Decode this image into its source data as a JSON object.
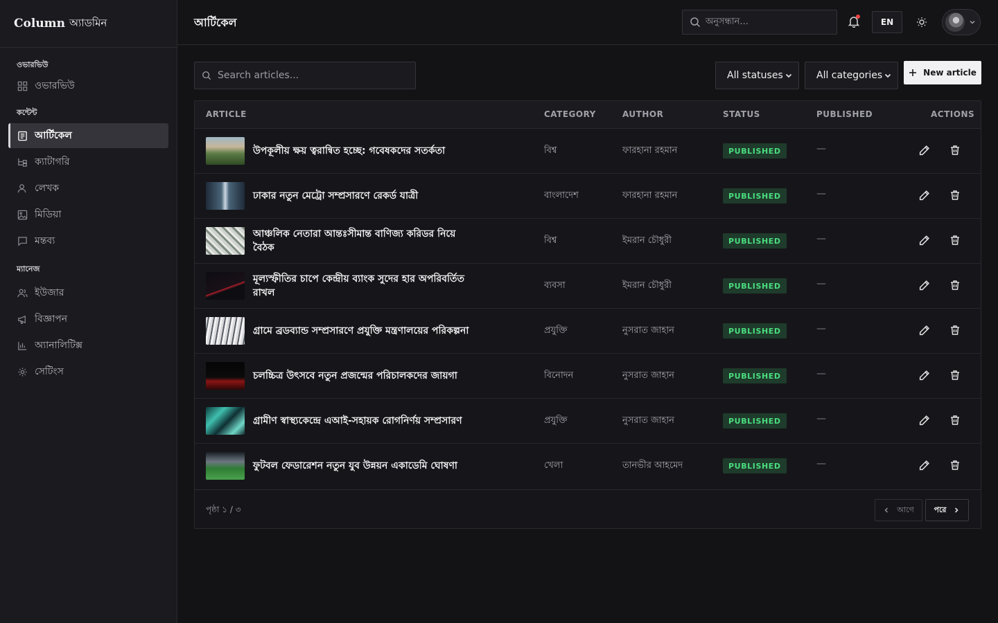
{
  "brand": {
    "name": "Column",
    "sub": "অ্যাডমিন"
  },
  "sidebar": {
    "sections": [
      {
        "heading": "ওভারভিউ",
        "items": [
          {
            "label": "ওভারভিউ",
            "icon": "grid-icon"
          }
        ]
      },
      {
        "heading": "কন্টেন্ট",
        "items": [
          {
            "label": "আর্টিকেল",
            "icon": "article-icon",
            "active": true
          },
          {
            "label": "ক্যাটাগরি",
            "icon": "category-icon"
          },
          {
            "label": "লেখক",
            "icon": "user-icon"
          },
          {
            "label": "মিডিয়া",
            "icon": "image-icon"
          },
          {
            "label": "মন্তব্য",
            "icon": "comment-icon"
          }
        ]
      },
      {
        "heading": "ম্যানেজ",
        "items": [
          {
            "label": "ইউজার",
            "icon": "users-icon"
          },
          {
            "label": "বিজ্ঞাপন",
            "icon": "megaphone-icon"
          },
          {
            "label": "অ্যানালিটিক্স",
            "icon": "chart-icon"
          },
          {
            "label": "সেটিংস",
            "icon": "gear-icon"
          }
        ]
      }
    ]
  },
  "topbar": {
    "title": "আর্টিকেল",
    "search_placeholder": "অনুসন্ধান...",
    "lang": "EN",
    "has_notification": true
  },
  "toolbar": {
    "search_placeholder": "Search articles...",
    "status_filter": "All statuses",
    "category_filter": "All categories",
    "new_label": "New article"
  },
  "table": {
    "columns": [
      "ARTICLE",
      "CATEGORY",
      "AUTHOR",
      "STATUS",
      "PUBLISHED",
      "ACTIONS"
    ],
    "rows": [
      {
        "title": "উপকূলীয় ক্ষয় ত্বরান্বিত হচ্ছে: গবেষকদের সতর্কতা",
        "category": "বিশ্ব",
        "author": "ফারহানা রহমান",
        "status": "PUBLISHED",
        "published": "—",
        "thumb": "landscape"
      },
      {
        "title": "ঢাকার নতুন মেট্রো সম্প্রসারণে রেকর্ড যাত্রী",
        "category": "বাংলাদেশ",
        "author": "ফারহানা রহমান",
        "status": "PUBLISHED",
        "published": "—",
        "thumb": "city"
      },
      {
        "title": "আঞ্চলিক নেতারা আন্তঃসীমান্ত বাণিজ্য করিডর নিয়ে বৈঠক",
        "category": "বিশ্ব",
        "author": "ইমরান চৌধুরী",
        "status": "PUBLISHED",
        "published": "—",
        "thumb": "money"
      },
      {
        "title": "মূল্যস্ফীতির চাপে কেন্দ্রীয় ব্যাংক সুদের হার অপরিবর্তিত রাখল",
        "category": "ব্যবসা",
        "author": "ইমরান চৌধুরী",
        "status": "PUBLISHED",
        "published": "—",
        "thumb": "chart"
      },
      {
        "title": "গ্রামে ব্রডব্যান্ড সম্প্রসারণে প্রযুক্তি মন্ত্রণালয়ের পরিকল্পনা",
        "category": "প্রযুক্তি",
        "author": "নুসরাত জাহান",
        "status": "PUBLISHED",
        "published": "—",
        "thumb": "cables"
      },
      {
        "title": "চলচ্চিত্র উৎসবে নতুন প্রজন্মের পরিচালকদের জায়গা",
        "category": "বিনোদন",
        "author": "নুসরাত জাহান",
        "status": "PUBLISHED",
        "published": "—",
        "thumb": "cinema"
      },
      {
        "title": "গ্রামীণ স্বাস্থ্যকেন্দ্রে এআই-সহায়ক রোগনির্ণয় সম্প্রসারণ",
        "category": "প্রযুক্তি",
        "author": "নুসরাত জাহান",
        "status": "PUBLISHED",
        "published": "—",
        "thumb": "circuit"
      },
      {
        "title": "ফুটবল ফেডারেশন নতুন যুব উন্নয়ন একাডেমি ঘোষণা",
        "category": "খেলা",
        "author": "তানভীর আহমেদ",
        "status": "PUBLISHED",
        "published": "—",
        "thumb": "stadium"
      }
    ]
  },
  "pagination": {
    "label": "পৃষ্ঠা ১ / ৩",
    "prev": "আগে",
    "next": "পরে"
  }
}
